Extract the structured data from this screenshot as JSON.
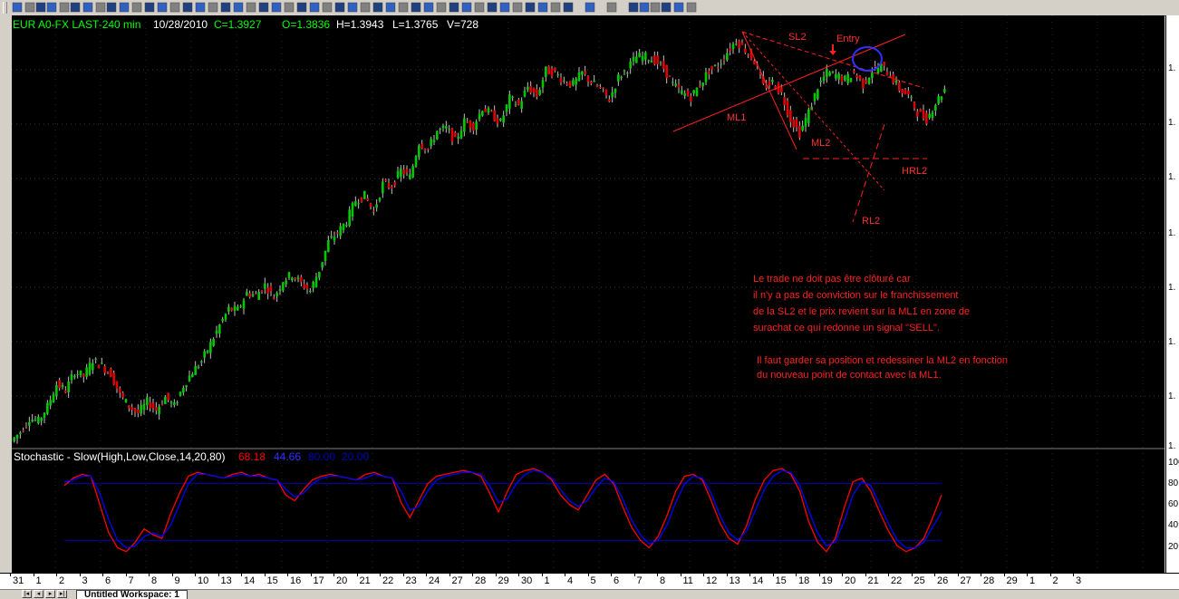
{
  "header": {
    "symbol": "EUR A0-FX LAST-240 min",
    "date": "10/28/2010",
    "close": "C=1.3927",
    "open": "O=1.3836",
    "high": "H=1.3943",
    "low": "L=1.3765",
    "volume": "V=728"
  },
  "stochastic": {
    "title": "Stochastic - Slow(High,Low,Close,14,20,80)",
    "k_value": "68.18",
    "d_value": "44.66",
    "upper_level": "80.00",
    "lower_level": "20.00",
    "scale_ticks": [
      "100",
      "80",
      "60",
      "40",
      "20"
    ]
  },
  "price_scale": {
    "ticks": [
      "1.",
      "1.",
      "1.",
      "1.",
      "1.",
      "1.",
      "1.",
      "1."
    ]
  },
  "annotations": {
    "sl2": "SL2",
    "entry": "Entry",
    "ml1": "ML1",
    "ml2": "ML2",
    "hrl2": "HRL2",
    "rl2": "RL2"
  },
  "comment": {
    "line1": "Le trade ne doit pas être clôturé car",
    "line2": "il n'y a pas de conviction sur le franchissement",
    "line3": "de la SL2 et le prix revient sur la ML1 en zone de",
    "line4": "surachat ce qui redonne un signal \"SELL\".",
    "line5": "Il faut garder sa position et redessiner la ML2 en fonction",
    "line6": "du nouveau point de contact avec la ML1."
  },
  "date_axis": [
    "31",
    "1",
    "2",
    "3",
    "6",
    "7",
    "8",
    "9",
    "10",
    "13",
    "14",
    "15",
    "16",
    "17",
    "20",
    "21",
    "22",
    "23",
    "24",
    "27",
    "28",
    "29",
    "30",
    "1",
    "4",
    "5",
    "6",
    "7",
    "8",
    "11",
    "12",
    "13",
    "14",
    "15",
    "18",
    "19",
    "20",
    "21",
    "22",
    "25",
    "26",
    "27",
    "28",
    "29",
    "1",
    "2",
    "3"
  ],
  "workspace_tab": "Untitled Workspace:  1",
  "colors": {
    "up": "#00c800",
    "down": "#e00000",
    "k_line": "#ff0000",
    "d_line": "#0000ff",
    "annotation": "#ff2020",
    "header_text": "#00ff00"
  },
  "chart_data": {
    "type": "candlestick",
    "title": "EUR A0-FX LAST-240 min",
    "price_series": [
      1.27,
      1.276,
      1.2745,
      1.281,
      1.2905,
      1.288,
      1.296,
      1.294,
      1.301,
      1.2985,
      1.295,
      1.286,
      1.281,
      1.278,
      1.283,
      1.2795,
      1.285,
      1.281,
      1.29,
      1.296,
      1.3005,
      1.308,
      1.316,
      1.323,
      1.3225,
      1.33,
      1.329,
      1.3335,
      1.328,
      1.3355,
      1.338,
      1.334,
      1.331,
      1.34,
      1.352,
      1.356,
      1.361,
      1.37,
      1.372,
      1.365,
      1.377,
      1.376,
      1.383,
      1.38,
      1.395,
      1.392,
      1.4,
      1.401,
      1.3955,
      1.404,
      1.402,
      1.41,
      1.407,
      1.4035,
      1.414,
      1.411,
      1.419,
      1.415,
      1.426,
      1.425,
      1.4215,
      1.42,
      1.425,
      1.421,
      1.418,
      1.4135,
      1.423,
      1.427,
      1.432,
      1.432,
      1.4305,
      1.427,
      1.42,
      1.4165,
      1.4145,
      1.42,
      1.426,
      1.428,
      1.434,
      1.439,
      1.435,
      1.43,
      1.419,
      1.421,
      1.416,
      1.405,
      1.399,
      1.408,
      1.419,
      1.425,
      1.424,
      1.422,
      1.425,
      1.42,
      1.426,
      1.428,
      1.424,
      1.418,
      1.415,
      1.408,
      1.405,
      1.412,
      1.418
    ],
    "stoch_k": [
      78,
      86,
      90,
      88,
      58,
      28,
      12,
      8,
      18,
      32,
      26,
      22,
      48,
      70,
      88,
      92,
      90,
      88,
      86,
      90,
      92,
      88,
      90,
      86,
      84,
      68,
      62,
      74,
      84,
      88,
      90,
      88,
      86,
      84,
      90,
      92,
      88,
      86,
      60,
      44,
      62,
      80,
      88,
      90,
      92,
      94,
      92,
      88,
      70,
      50,
      72,
      90,
      94,
      96,
      92,
      84,
      68,
      58,
      52,
      68,
      84,
      90,
      80,
      56,
      34,
      20,
      12,
      24,
      46,
      72,
      88,
      90,
      84,
      62,
      38,
      22,
      16,
      36,
      64,
      84,
      94,
      96,
      90,
      72,
      40,
      18,
      8,
      22,
      54,
      82,
      86,
      72,
      50,
      30,
      14,
      8,
      12,
      22,
      44,
      68
    ],
    "stoch_d": [
      82,
      84,
      88,
      88,
      70,
      42,
      20,
      12,
      14,
      24,
      28,
      24,
      36,
      58,
      80,
      90,
      90,
      88,
      86,
      88,
      90,
      88,
      88,
      86,
      84,
      74,
      66,
      70,
      80,
      86,
      88,
      88,
      86,
      84,
      86,
      90,
      88,
      86,
      72,
      52,
      56,
      72,
      84,
      88,
      90,
      92,
      92,
      90,
      78,
      60,
      64,
      80,
      90,
      94,
      92,
      86,
      74,
      62,
      56,
      62,
      76,
      86,
      82,
      64,
      42,
      26,
      16,
      20,
      36,
      60,
      80,
      88,
      86,
      70,
      46,
      28,
      20,
      30,
      52,
      74,
      88,
      94,
      92,
      78,
      52,
      28,
      14,
      18,
      40,
      68,
      82,
      78,
      58,
      38,
      20,
      12,
      12,
      18,
      34,
      50
    ],
    "stoch_levels": [
      80,
      20
    ],
    "ylim_stoch": [
      0,
      100
    ],
    "x_dates": [
      "31",
      "1",
      "2",
      "3",
      "6",
      "7",
      "8",
      "9",
      "10",
      "13",
      "14",
      "15",
      "16",
      "17",
      "20",
      "21",
      "22",
      "23",
      "24",
      "27",
      "28",
      "29",
      "30",
      "1",
      "4",
      "5",
      "6",
      "7",
      "8",
      "11",
      "12",
      "13",
      "14",
      "15",
      "18",
      "19",
      "20",
      "21",
      "22",
      "25",
      "26",
      "27",
      "28"
    ]
  }
}
